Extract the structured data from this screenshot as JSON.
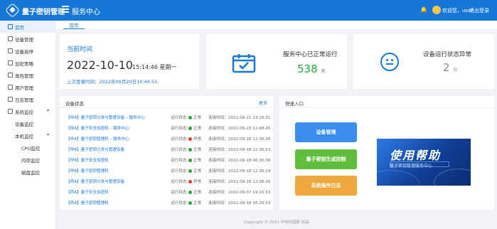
{
  "header": {
    "brand": "量子密钥管理",
    "page": "服务中心",
    "welcome": "欢迎您，user",
    "logout": "退出登录",
    "colors": {
      "bar": "#1677d6"
    }
  },
  "sidebar": {
    "items": [
      {
        "label": "首页",
        "active": true
      },
      {
        "label": "设备管理"
      },
      {
        "label": "设备启停"
      },
      {
        "label": "加密策略"
      },
      {
        "label": "角色管理"
      },
      {
        "label": "用户管理"
      },
      {
        "label": "日志管理"
      },
      {
        "label": "系统监控",
        "expanded": true
      },
      {
        "label": "设备监控",
        "level": 1
      },
      {
        "label": "本机监控",
        "level": 1,
        "expanded": true
      },
      {
        "label": "CPU监控",
        "level": 2
      },
      {
        "label": "内存监控",
        "level": 2
      },
      {
        "label": "磁盘监控",
        "level": 2
      }
    ]
  },
  "tabs": [
    {
      "label": "首页"
    }
  ],
  "time_card": {
    "title": "当前时间",
    "date": "2022-10-10",
    "time": "15:14:46 星期一",
    "last_login": "上次登录时间：2022年09月20日10:44:55"
  },
  "service_card": {
    "title": "服务中心已正常运行",
    "value": "538",
    "unit": "天"
  },
  "abnormal_card": {
    "title": "设备运行状态异常",
    "value": "2",
    "unit": "台"
  },
  "device_panel": {
    "title": "设备状态",
    "more": "更多",
    "status_label": "运行状态：",
    "conn_label": "连接时间：",
    "rows": [
      {
        "name": "【甲A】量子密钥分发与管理设备 – 服务中心",
        "status": "正常",
        "status_color": "#27a53a",
        "time": "2022-09-21 23:16:01"
      },
      {
        "name": "【甲A】量子安全加密机 – 服务中心",
        "status": "正常",
        "status_color": "#27a53a",
        "time": "2022-09-23 12:48:45"
      },
      {
        "name": "【甲A】量子密钥管理机 – 服务中心",
        "status": "异常",
        "status_color": "#e03b2f",
        "time": "2022-09-18 12:36:36"
      },
      {
        "name": "【甲B】量子密钥分发与管理设备",
        "status": "正常",
        "status_color": "#27a53a",
        "time": "2022-09-18 12:36:22"
      },
      {
        "name": "【甲B】量子安全加密机",
        "status": "正常",
        "status_color": "#27a53a",
        "time": "2022-09-18 06:36:36"
      },
      {
        "name": "【甲B】量子密钥管理机",
        "status": "正常",
        "status_color": "#27a53a",
        "time": "2022-09-18 12:36:19"
      },
      {
        "name": "【丙A】量子密钥分发与管理设备",
        "status": "异常",
        "status_color": "#e03b2f",
        "time": "2022-09-18 12:36:36"
      },
      {
        "name": "【丙A】量子安全加密机",
        "status": "正常",
        "status_color": "#27a53a",
        "time": "2022-09-07 19:16:33"
      },
      {
        "name": "【丙A】量子密钥管理机",
        "status": "正常",
        "status_color": "#27a53a",
        "time": "2022-09-18 16:26:59"
      }
    ]
  },
  "quick_panel": {
    "title": "快速入口",
    "buttons": [
      {
        "label": "设备管理",
        "color": "#3a8ef0"
      },
      {
        "label": "量子密钥生成控制",
        "color": "#5fbf3d"
      },
      {
        "label": "系统操作日志",
        "color": "#f0a63a"
      }
    ],
    "banner": {
      "title": "使用帮助",
      "subtitle": "量子密钥管理服务中心"
    }
  },
  "footer": "Copyright © 2021 中电科国影 出品"
}
